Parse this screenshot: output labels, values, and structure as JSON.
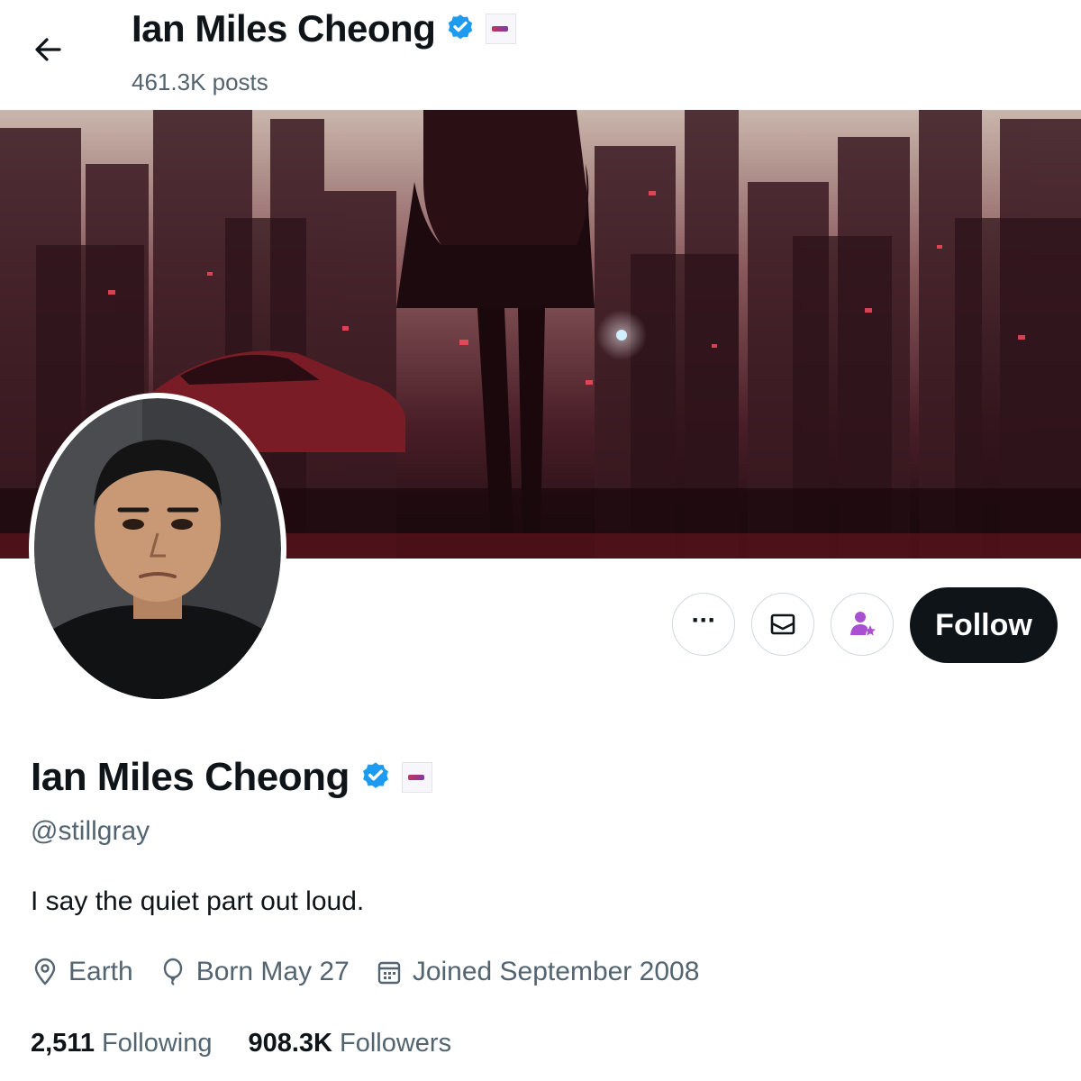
{
  "header": {
    "name": "Ian Miles Cheong",
    "posts_count": "461.3K posts"
  },
  "profile": {
    "name": "Ian Miles Cheong",
    "handle": "@stillgray",
    "bio": "I say the quiet part out loud.",
    "location": "Earth",
    "birthday": "Born May 27",
    "joined": "Joined September 2008",
    "following_count": "2,511",
    "following_label": "Following",
    "followers_count": "908.3K",
    "followers_label": "Followers"
  },
  "actions": {
    "more_label": "···",
    "follow_label": "Follow"
  },
  "icons": {
    "back": "arrow-left-icon",
    "verified": "verified-badge-icon",
    "affiliate": "affiliate-badge-icon",
    "more": "more-options-icon",
    "message": "envelope-icon",
    "subscribe": "subscribe-user-star-icon",
    "location": "location-pin-icon",
    "birthday": "balloon-icon",
    "joined": "calendar-icon"
  },
  "colors": {
    "verified": "#1d9bf0",
    "subscribe": "#a94fd1",
    "follow_button": "#0f1419",
    "secondary_text": "#536471"
  }
}
